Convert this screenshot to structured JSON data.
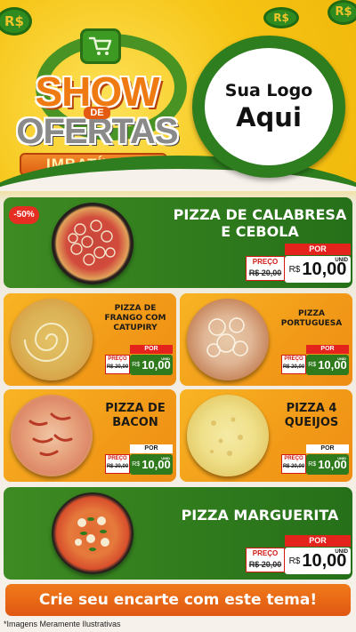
{
  "header": {
    "coins": [
      "R$",
      "R$",
      "R$"
    ],
    "title_line1": "SHOW",
    "title_de": "DE",
    "title_line2": "OFERTAS",
    "subtitle": "IMBATÍVEIS",
    "logo_line1": "Sua Logo",
    "logo_line2": "Aqui"
  },
  "offers": [
    {
      "name": "PIZZA DE CALABRESA E CEBOLA",
      "badge": "-50%",
      "por": "POR",
      "preco": "PREÇO",
      "old": "R$ 20,00",
      "currency": "R$",
      "price": "10,00",
      "unit": "UNID"
    },
    {
      "name": "PIZZA DE FRANGO COM CATUPIRY",
      "por": "POR",
      "preco": "PREÇO",
      "old": "R$ 20,00",
      "currency": "R$",
      "price": "10,00",
      "unit": "UNID"
    },
    {
      "name": "PIZZA PORTUGUESA",
      "por": "POR",
      "preco": "PREÇO",
      "old": "R$ 20,00",
      "currency": "R$",
      "price": "10,00",
      "unit": "UNID"
    },
    {
      "name": "PIZZA DE BACON",
      "por": "POR",
      "preco": "PREÇO",
      "old": "R$ 20,00",
      "currency": "R$",
      "price": "10,00",
      "unit": "UNID"
    },
    {
      "name": "PIZZA 4 QUEIJOS",
      "por": "POR",
      "preco": "PREÇO",
      "old": "R$ 20,00",
      "currency": "R$",
      "price": "10,00",
      "unit": "UNID"
    },
    {
      "name": "PIZZA MARGUERITA",
      "por": "POR",
      "preco": "PREÇO",
      "old": "R$ 20,00",
      "currency": "R$",
      "price": "10,00",
      "unit": "UNID"
    }
  ],
  "cta_label": "Crie seu encarte com este tema!",
  "disclaimer": "*Imagens Meramente Ilustrativas",
  "colors": {
    "green": "#2f7a1c",
    "orange": "#f29a18",
    "red": "#e3231c",
    "yellow": "#f6c414"
  }
}
